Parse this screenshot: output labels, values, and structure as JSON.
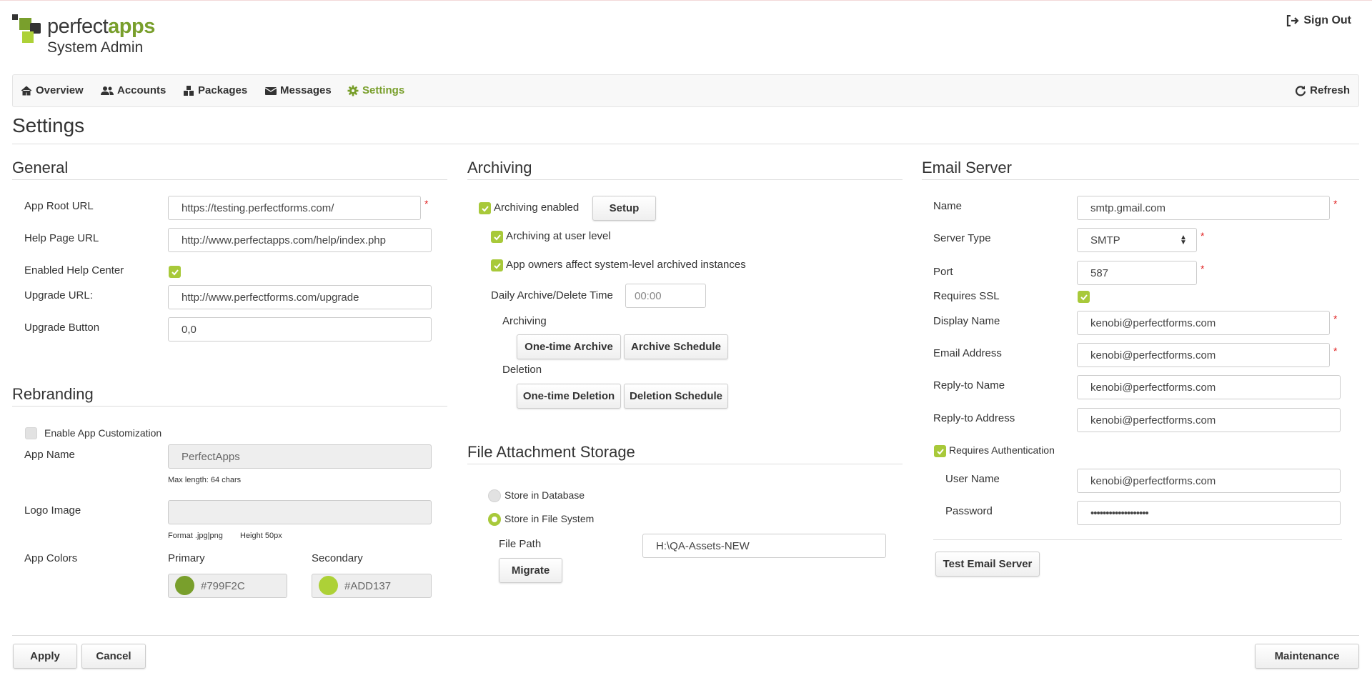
{
  "header": {
    "brand_perfect": "perfect",
    "brand_apps": "apps",
    "subtitle": "System Admin",
    "sign_out": "Sign Out"
  },
  "nav": {
    "items": [
      {
        "label": "Overview",
        "icon": "home-icon"
      },
      {
        "label": "Accounts",
        "icon": "users-icon"
      },
      {
        "label": "Packages",
        "icon": "cubes-icon"
      },
      {
        "label": "Messages",
        "icon": "envelope-icon"
      },
      {
        "label": "Settings",
        "icon": "gear-icon",
        "active": true
      }
    ],
    "refresh": "Refresh"
  },
  "page_title": "Settings",
  "general": {
    "title": "General",
    "app_root_url_label": "App Root URL",
    "app_root_url": "https://testing.perfectforms.com/",
    "help_page_url_label": "Help Page URL",
    "help_page_url": "http://www.perfectapps.com/help/index.php",
    "enabled_help_center_label": "Enabled Help Center",
    "enabled_help_center": true,
    "upgrade_url_label": "Upgrade URL:",
    "upgrade_url": "http://www.perfectforms.com/upgrade",
    "upgrade_button_label": "Upgrade Button",
    "upgrade_button": "0,0"
  },
  "rebranding": {
    "title": "Rebranding",
    "enable_customization_label": "Enable App Customization",
    "enable_customization": false,
    "app_name_label": "App Name",
    "app_name": "PerfectApps",
    "app_name_hint": "Max length: 64 chars",
    "logo_image_label": "Logo Image",
    "logo_format_hint": "Format .jpg|png",
    "logo_height_hint": "Height 50px",
    "app_colors_label": "App Colors",
    "primary_label": "Primary",
    "primary_color": "#799F2C",
    "secondary_label": "Secondary",
    "secondary_color": "#ADD137"
  },
  "archiving": {
    "title": "Archiving",
    "enabled_label": "Archiving enabled",
    "enabled": true,
    "setup_button": "Setup",
    "user_level_label": "Archiving at user level",
    "user_level": true,
    "owners_affect_label": "App owners affect system-level archived instances",
    "owners_affect": true,
    "daily_time_label": "Daily Archive/Delete Time",
    "daily_time_placeholder": "00:00",
    "archiving_sub": "Archiving",
    "one_time_archive": "One-time Archive",
    "archive_schedule": "Archive Schedule",
    "deletion_sub": "Deletion",
    "one_time_deletion": "One-time Deletion",
    "deletion_schedule": "Deletion Schedule"
  },
  "file_storage": {
    "title": "File Attachment Storage",
    "store_db_label": "Store in Database",
    "store_fs_label": "Store in File System",
    "selected": "Store in File System",
    "file_path_label": "File Path",
    "file_path": "H:\\QA-Assets-NEW",
    "migrate_button": "Migrate"
  },
  "email": {
    "title": "Email Server",
    "name_label": "Name",
    "name": "smtp.gmail.com",
    "server_type_label": "Server Type",
    "server_type": "SMTP",
    "port_label": "Port",
    "port": "587",
    "requires_ssl_label": "Requires SSL",
    "requires_ssl": true,
    "display_name_label": "Display Name",
    "display_name": "kenobi@perfectforms.com",
    "email_address_label": "Email Address",
    "email_address": "kenobi@perfectforms.com",
    "reply_to_name_label": "Reply-to Name",
    "reply_to_name": "kenobi@perfectforms.com",
    "reply_to_address_label": "Reply-to Address",
    "reply_to_address": "kenobi@perfectforms.com",
    "requires_auth_label": "Requires Authentication",
    "requires_auth": true,
    "user_name_label": "User Name",
    "user_name": "kenobi@perfectforms.com",
    "password_label": "Password",
    "password": "•••••••••••••••••••",
    "test_button": "Test Email Server"
  },
  "footer": {
    "apply": "Apply",
    "cancel": "Cancel",
    "maintenance": "Maintenance"
  },
  "required_marker": "*"
}
